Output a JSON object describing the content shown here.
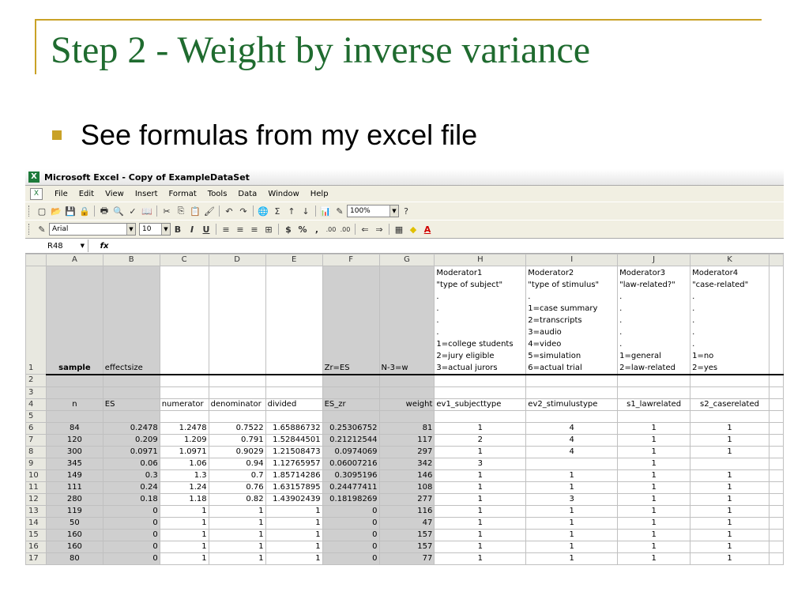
{
  "slide": {
    "title": "Step 2 - Weight by inverse variance",
    "bullet": "See formulas from my excel file"
  },
  "excel": {
    "window_title": "Microsoft Excel - Copy of ExampleDataSet",
    "menus": [
      "File",
      "Edit",
      "View",
      "Insert",
      "Format",
      "Tools",
      "Data",
      "Window",
      "Help"
    ],
    "zoom": "100%",
    "font_name": "Arial",
    "font_size": "10",
    "name_box": "R48",
    "fx": "fx",
    "format_buttons": [
      "B",
      "I",
      "U",
      "$",
      "%",
      ",",
      ".00",
      "⇐",
      "⇒"
    ],
    "columns": [
      "A",
      "B",
      "C",
      "D",
      "E",
      "F",
      "G",
      "H",
      "I",
      "J",
      "K"
    ],
    "row1": {
      "num": "1",
      "A": "sample",
      "B": "effectsize",
      "F": "Zr=ES",
      "G": "N-3=w",
      "H": [
        "Moderator1",
        "\"type of subject\"",
        ".",
        ".",
        ".",
        ".",
        "1=college students",
        "2=jury eligible",
        "3=actual jurors"
      ],
      "I": [
        "Moderator2",
        "\"type of stimulus\"",
        ".",
        "1=case summary",
        "2=transcripts",
        "3=audio",
        "4=video",
        "5=simulation",
        "6=actual trial"
      ],
      "J": [
        "Moderator3",
        "\"law-related?\"",
        ".",
        ".",
        ".",
        ".",
        ".",
        "1=general",
        "2=law-related"
      ],
      "K": [
        "Moderator4",
        "\"case-related\"",
        ".",
        ".",
        ".",
        ".",
        ".",
        "1=no",
        "2=yes"
      ]
    },
    "row4": [
      "n",
      "ES",
      "numerator",
      "denominator",
      "divided",
      "ES_zr",
      "weight",
      "ev1_subjecttype",
      "ev2_stimulustype",
      "s1_lawrelated",
      "s2_caserelated"
    ],
    "data_rows": [
      {
        "row": "6",
        "cells": [
          "84",
          "0.2478",
          "1.2478",
          "0.7522",
          "1.65886732",
          "0.25306752",
          "81",
          "1",
          "4",
          "1",
          "1"
        ]
      },
      {
        "row": "7",
        "cells": [
          "120",
          "0.209",
          "1.209",
          "0.791",
          "1.52844501",
          "0.21212544",
          "117",
          "2",
          "4",
          "1",
          "1"
        ]
      },
      {
        "row": "8",
        "cells": [
          "300",
          "0.0971",
          "1.0971",
          "0.9029",
          "1.21508473",
          "0.0974069",
          "297",
          "1",
          "4",
          "1",
          "1"
        ]
      },
      {
        "row": "9",
        "cells": [
          "345",
          "0.06",
          "1.06",
          "0.94",
          "1.12765957",
          "0.06007216",
          "342",
          "3",
          "",
          "1",
          ""
        ]
      },
      {
        "row": "10",
        "cells": [
          "149",
          "0.3",
          "1.3",
          "0.7",
          "1.85714286",
          "0.3095196",
          "146",
          "1",
          "1",
          "1",
          "1"
        ]
      },
      {
        "row": "11",
        "cells": [
          "111",
          "0.24",
          "1.24",
          "0.76",
          "1.63157895",
          "0.24477411",
          "108",
          "1",
          "1",
          "1",
          "1"
        ]
      },
      {
        "row": "12",
        "cells": [
          "280",
          "0.18",
          "1.18",
          "0.82",
          "1.43902439",
          "0.18198269",
          "277",
          "1",
          "3",
          "1",
          "1"
        ]
      },
      {
        "row": "13",
        "cells": [
          "119",
          "0",
          "1",
          "1",
          "1",
          "0",
          "116",
          "1",
          "1",
          "1",
          "1"
        ]
      },
      {
        "row": "14",
        "cells": [
          "50",
          "0",
          "1",
          "1",
          "1",
          "0",
          "47",
          "1",
          "1",
          "1",
          "1"
        ]
      },
      {
        "row": "15",
        "cells": [
          "160",
          "0",
          "1",
          "1",
          "1",
          "0",
          "157",
          "1",
          "1",
          "1",
          "1"
        ]
      },
      {
        "row": "16",
        "cells": [
          "160",
          "0",
          "1",
          "1",
          "1",
          "0",
          "157",
          "1",
          "1",
          "1",
          "1"
        ]
      },
      {
        "row": "17",
        "cells": [
          "80",
          "0",
          "1",
          "1",
          "1",
          "0",
          "77",
          "1",
          "1",
          "1",
          "1"
        ]
      }
    ]
  }
}
